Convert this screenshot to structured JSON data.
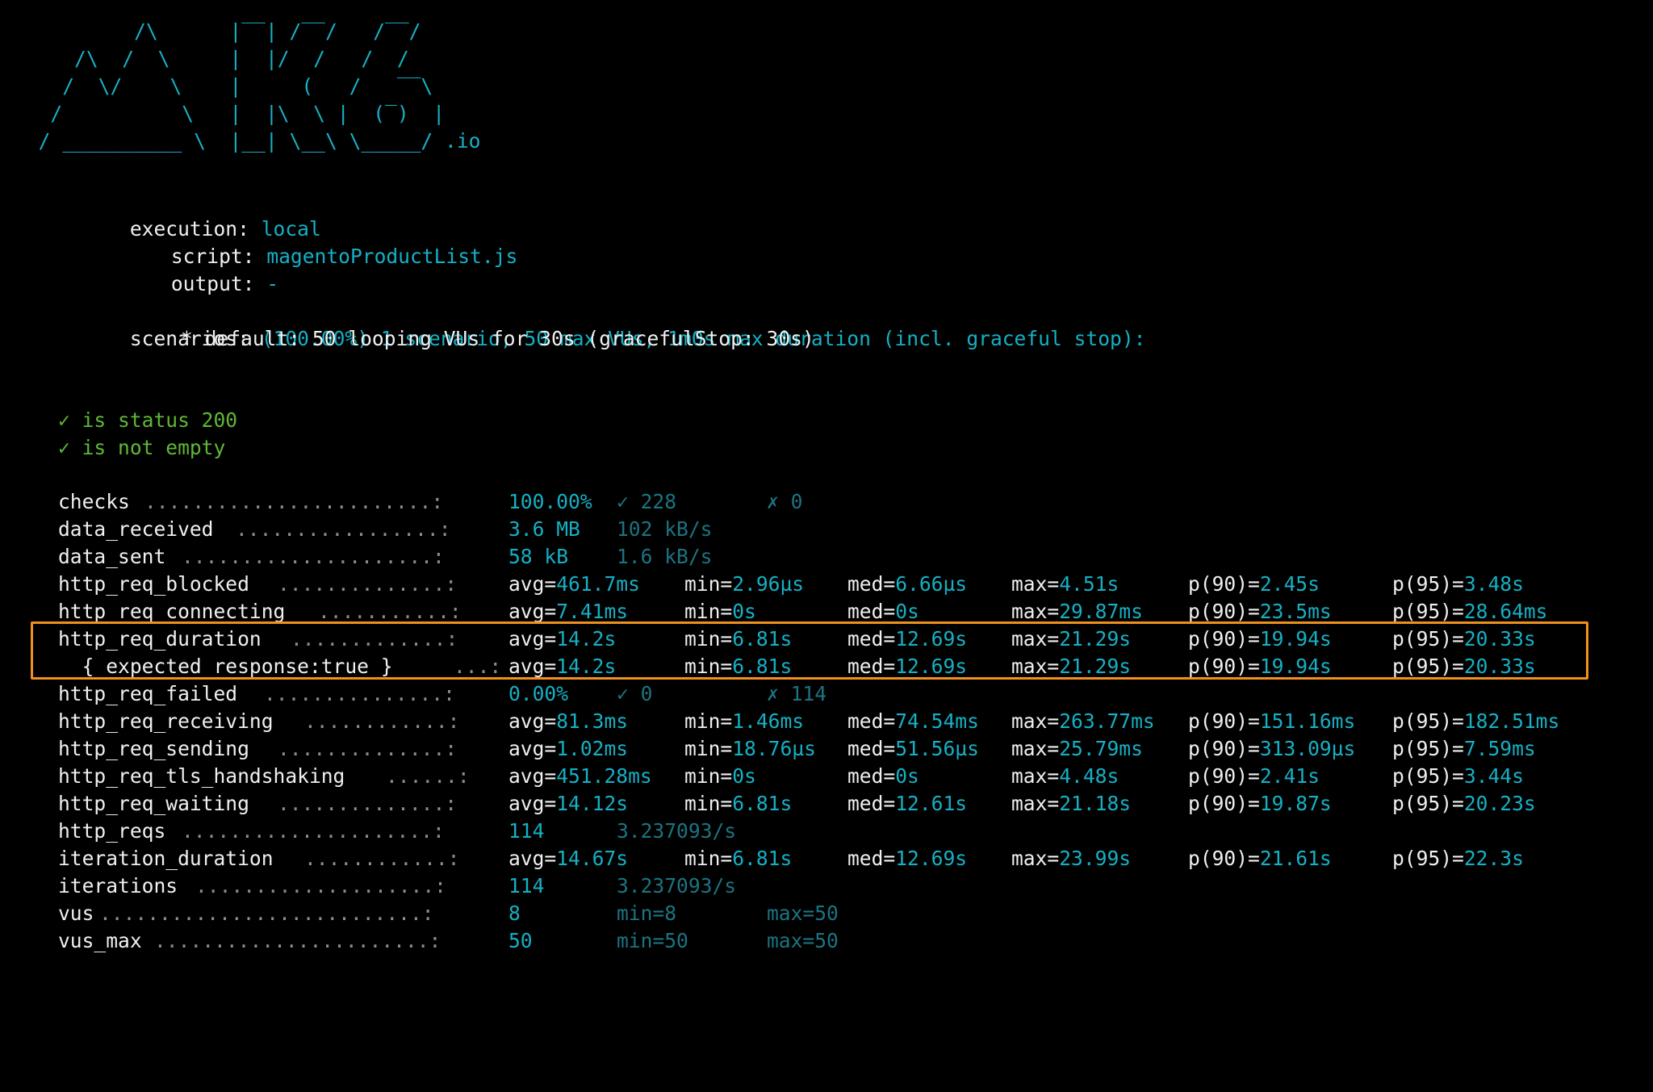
{
  "logo": {
    "lines": [
      "          /\\      |‾‾| /‾‾/   /‾‾/   ",
      "     /\\  /  \\     |  |/  /   /  /    ",
      "    /  \\/    \\    |     (   /   ‾‾\\  ",
      "   /          \\   |  |\\  \\ |  (‾)  | ",
      "  / __________ \\  |__| \\__\\ \\_____/ .io"
    ]
  },
  "run_info": {
    "execution_label": "execution:",
    "execution_value": "local",
    "script_label": "script:",
    "script_value": "magentoProductList.js",
    "output_label": "output:",
    "output_value": "-",
    "scenarios_label": "scenarios:",
    "scenarios_value": "(100.00%) 1 scenario, 50 max VUs, 1m0s max duration (incl. graceful stop):",
    "scenario_detail": "* default: 50 looping VUs for 30s (gracefulStop: 30s)"
  },
  "checks_list": [
    "✓ is status 200",
    "✓ is not empty"
  ],
  "colors": {
    "background": "#000000",
    "logo": "#16b0c4",
    "value": "#16b0c4",
    "dim_value": "#1b7482",
    "check_pass": "#5fb835",
    "highlight": "#f0901e"
  },
  "metrics": [
    {
      "name": "checks",
      "dots": "........................:",
      "c1": "100.00%",
      "c2": "✓ 228",
      "c3": "✗ 0"
    },
    {
      "name": "data_received",
      "dots": ".................:",
      "c1": "3.6 MB",
      "c2": "102 kB/s"
    },
    {
      "name": "data_sent",
      "dots": ".....................:",
      "c1": "58 kB",
      "c2": "1.6 kB/s"
    },
    {
      "name": "http_req_blocked",
      "dots": "..............:",
      "avg": "461.7ms",
      "min": "2.96µs",
      "med": "6.66µs",
      "max": "4.51s",
      "p90": "2.45s",
      "p95": "3.48s"
    },
    {
      "name": "http_req_connecting",
      "dots": "...........:",
      "avg": "7.41ms",
      "min": "0s",
      "med": "0s",
      "max": "29.87ms",
      "p90": "23.5ms",
      "p95": "28.64ms"
    },
    {
      "name": "http_req_duration",
      "dots": ".............:",
      "avg": "14.2s",
      "min": "6.81s",
      "med": "12.69s",
      "max": "21.29s",
      "p90": "19.94s",
      "p95": "20.33s"
    },
    {
      "name": "  { expected_response:true }",
      "dots": "...:",
      "avg": "14.2s",
      "min": "6.81s",
      "med": "12.69s",
      "max": "21.29s",
      "p90": "19.94s",
      "p95": "20.33s"
    },
    {
      "name": "http_req_failed",
      "dots": "...............:",
      "c1": "0.00%",
      "c2": "✓ 0",
      "c3": "✗ 114"
    },
    {
      "name": "http_req_receiving",
      "dots": "............:",
      "avg": "81.3ms",
      "min": "1.46ms",
      "med": "74.54ms",
      "max": "263.77ms",
      "p90": "151.16ms",
      "p95": "182.51ms"
    },
    {
      "name": "http_req_sending",
      "dots": "..............:",
      "avg": "1.02ms",
      "min": "18.76µs",
      "med": "51.56µs",
      "max": "25.79ms",
      "p90": "313.09µs",
      "p95": "7.59ms"
    },
    {
      "name": "http_req_tls_handshaking",
      "dots": "......:",
      "avg": "451.28ms",
      "min": "0s",
      "med": "0s",
      "max": "4.48s",
      "p90": "2.41s",
      "p95": "3.44s"
    },
    {
      "name": "http_req_waiting",
      "dots": "..............:",
      "avg": "14.12s",
      "min": "6.81s",
      "med": "12.61s",
      "max": "21.18s",
      "p90": "19.87s",
      "p95": "20.23s"
    },
    {
      "name": "http_reqs",
      "dots": ".....................:",
      "c1": "114",
      "c2": "3.237093/s"
    },
    {
      "name": "iteration_duration",
      "dots": "............:",
      "avg": "14.67s",
      "min": "6.81s",
      "med": "12.69s",
      "max": "23.99s",
      "p90": "21.61s",
      "p95": "22.3s"
    },
    {
      "name": "iterations",
      "dots": "....................:",
      "c1": "114",
      "c2": "3.237093/s"
    },
    {
      "name": "vus",
      "dots": "...........................:",
      "c1": "8",
      "c2": "min=8",
      "c3": "max=50"
    },
    {
      "name": "vus_max",
      "dots": ".......................:",
      "c1": "50",
      "c2": "min=50",
      "c3": "max=50"
    }
  ]
}
